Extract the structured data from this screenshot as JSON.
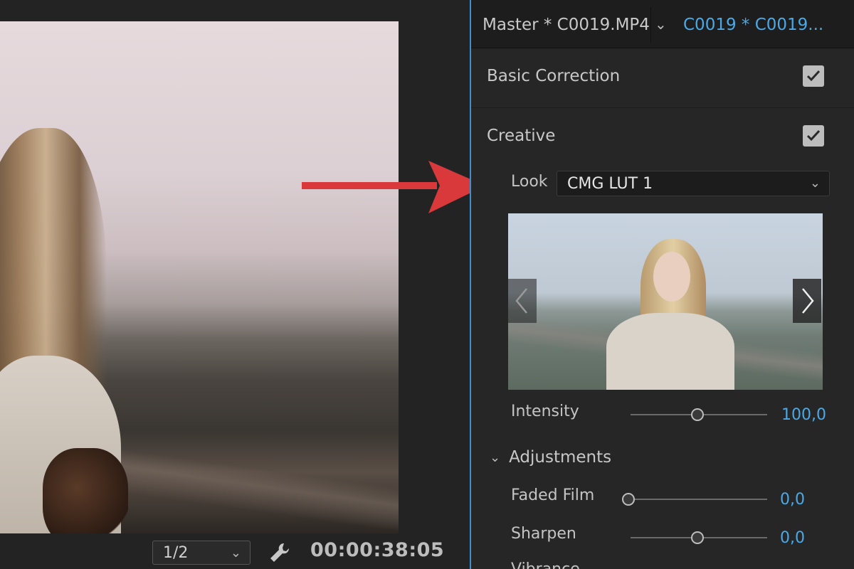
{
  "monitor": {
    "resolution": "1/2",
    "timecode": "00:00:38:05"
  },
  "panel": {
    "tab_master": "Master * C0019.MP4",
    "tab_clip": "C0019 * C0019...",
    "sections": {
      "basic_correction": {
        "label": "Basic Correction",
        "checked": true
      },
      "creative": {
        "label": "Creative",
        "checked": true
      }
    },
    "look": {
      "label": "Look",
      "value": "CMG LUT 1"
    },
    "intensity": {
      "label": "Intensity",
      "value": "100,0",
      "level": 0.5
    },
    "adjustments": {
      "label": "Adjustments",
      "items": [
        {
          "label": "Faded Film",
          "value": "0,0",
          "level": 0.0
        },
        {
          "label": "Sharpen",
          "value": "0,0",
          "level": 0.5
        }
      ],
      "partial_next_label": "Vibrance"
    }
  },
  "colors": {
    "accent": "#4aa9e6",
    "arrow": "#d9393a",
    "panel_border": "#3e8fd1"
  }
}
